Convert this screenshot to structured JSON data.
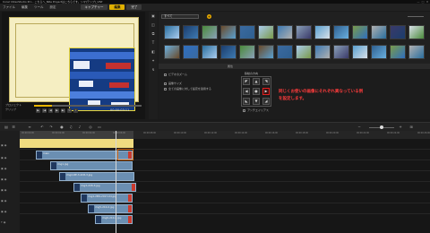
{
  "titlebar": {
    "title": "Corel VideoStudio Pro - こちらへ_NRe Projectはこちらです。ンマ(テンプ)_VSP",
    "min": "—",
    "max": "□",
    "close": "✕"
  },
  "menu": {
    "items": [
      "ファイル",
      "編集",
      "ツール",
      "設定"
    ],
    "tabs": [
      {
        "label": "キャプチャー",
        "active": false
      },
      {
        "label": "編集",
        "active": true
      },
      {
        "label": "完了",
        "active": false
      }
    ]
  },
  "preview": {
    "project_label": "プロジェクト",
    "clip_label": "クリップ",
    "timecode": "00:00:03:11",
    "progress": 0.17
  },
  "library": {
    "category": "すべて",
    "thumbs": [
      "",
      "",
      "",
      "",
      "",
      "",
      "",
      "",
      "",
      "",
      "",
      "",
      "",
      "",
      "",
      "",
      "",
      "",
      "",
      "",
      "",
      "",
      "",
      "",
      "",
      "",
      "",
      ""
    ],
    "tabs": [
      "属性",
      "",
      "",
      "属性"
    ],
    "options": [
      {
        "label": "ビデオのズーム"
      },
      {
        "label": "画像サイズ"
      },
      {
        "label": "全ての画像に対して設定を適用する"
      },
      {
        "label": "アンチエイリアス"
      }
    ],
    "grid_label": "移動の方向",
    "note_lines": [
      "同じくお使いの画像にそれぞれ異なっている例",
      "を設定します。"
    ]
  },
  "timeline": {
    "ruler": [
      "00:00:00:00",
      "00:00:02:00",
      "00:00:04:00",
      "00:00:06:00",
      "00:00:08:00",
      "00:00:10:00",
      "00:00:12:00",
      "00:00:14:00",
      "00:00:16:00",
      "00:00:18:00",
      "00:00:20:00",
      "00:00:22:00",
      "00:00:24:00",
      "00:00:26:00"
    ],
    "tracks": [
      "",
      "",
      "",
      "",
      "",
      "",
      "",
      ""
    ],
    "clips": [
      "main",
      "img1.jpg",
      "img2-RE-3-2C8-3.jpg",
      "img3-2C8-3.jpg",
      "img4-2M9-2017-04.jpg",
      "img5-210-2.jpg",
      "img6-210-2.jpg"
    ]
  },
  "colors": {
    "accent": "#e8b400",
    "note": "#ff3c3c",
    "clip": "#6b8fb2"
  }
}
